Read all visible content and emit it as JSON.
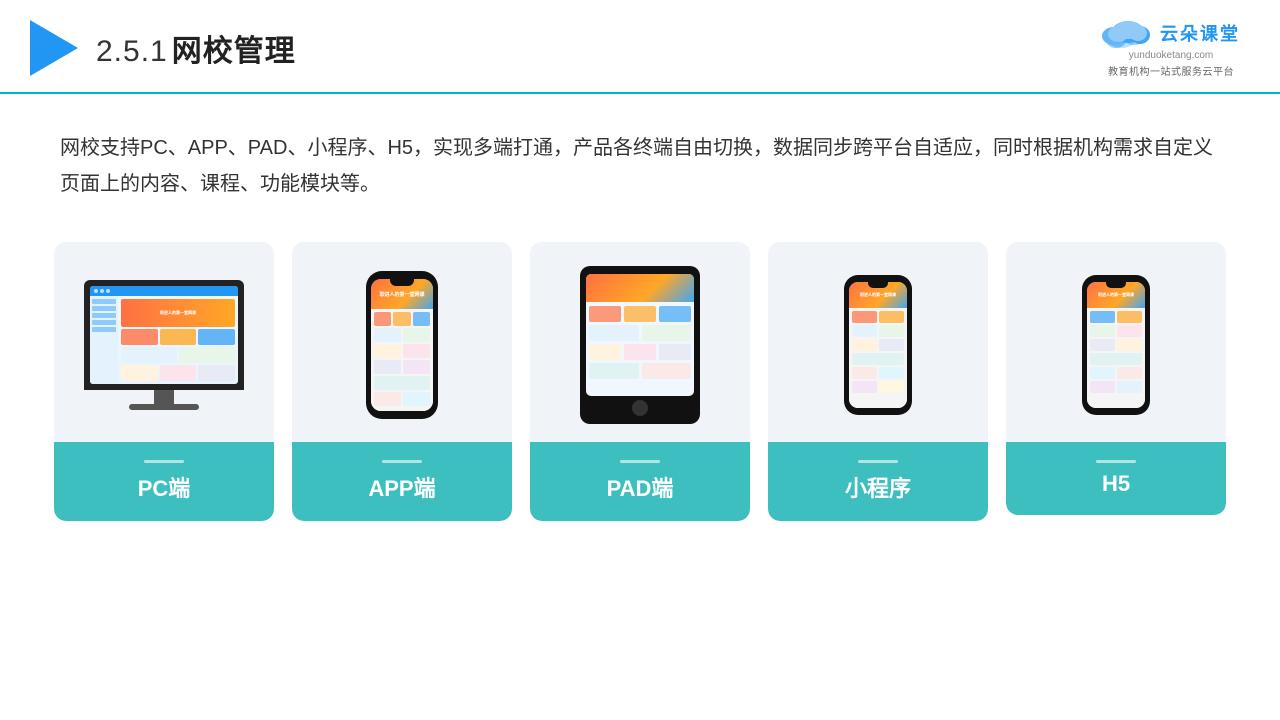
{
  "header": {
    "section_number": "2.5.1",
    "title": "网校管理",
    "brand_name": "云朵课堂",
    "brand_url": "yunduoketang.com",
    "brand_tagline": "教育机构一站式服务云平台"
  },
  "description": {
    "text": "网校支持PC、APP、PAD、小程序、H5，实现多端打通，产品各终端自由切换，数据同步跨平台自适应，同时根据机构需求自定义页面上的内容、课程、功能模块等。"
  },
  "cards": [
    {
      "id": "pc",
      "label": "PC端"
    },
    {
      "id": "app",
      "label": "APP端"
    },
    {
      "id": "pad",
      "label": "PAD端"
    },
    {
      "id": "miniprogram",
      "label": "小程序"
    },
    {
      "id": "h5",
      "label": "H5"
    }
  ],
  "colors": {
    "accent": "#3dbfbf",
    "header_line": "#00b8c4",
    "triangle": "#2196f3"
  }
}
